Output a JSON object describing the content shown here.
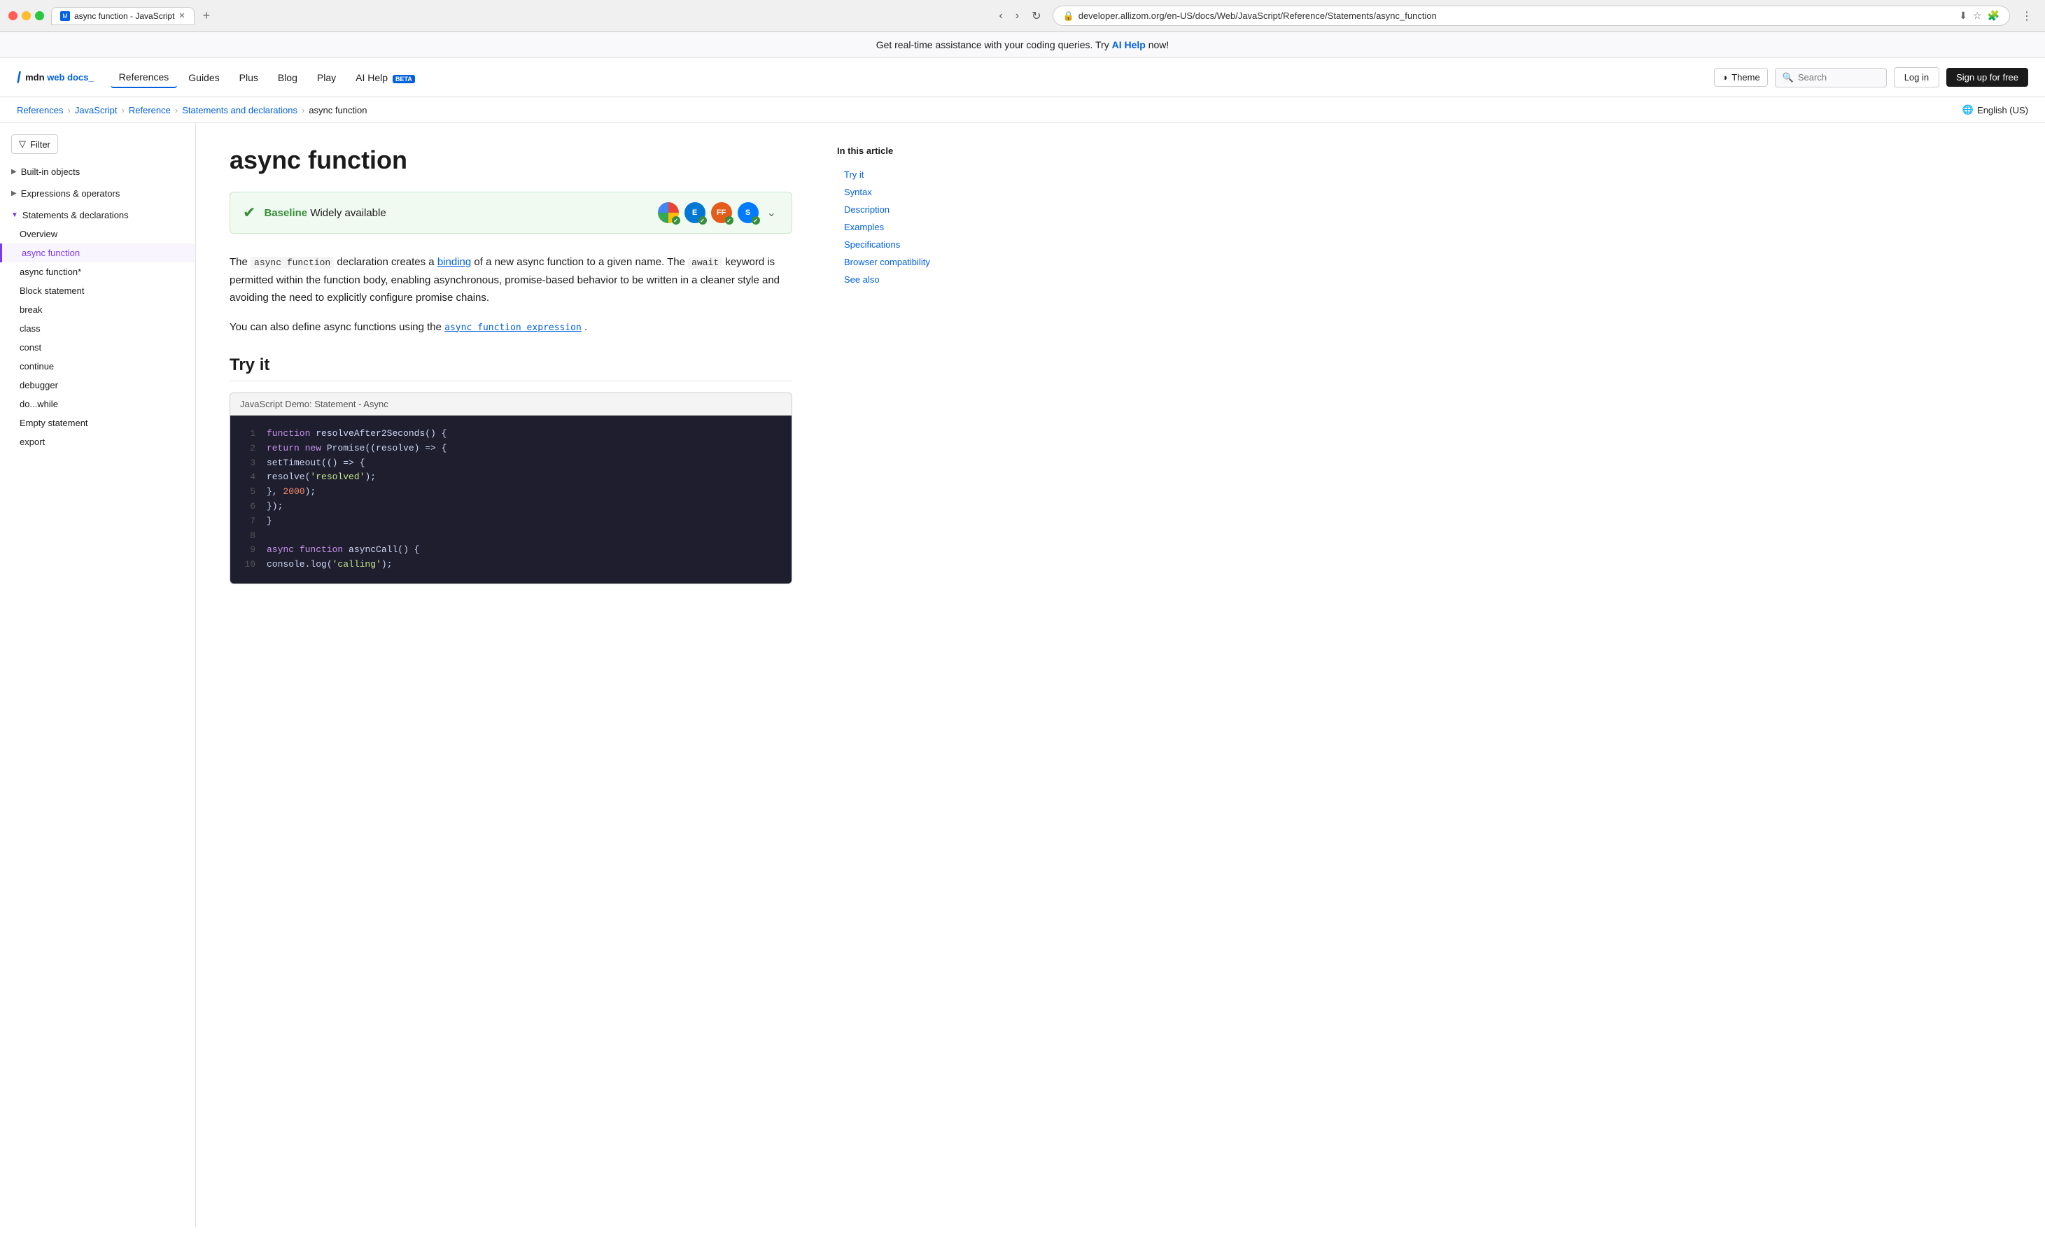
{
  "browser": {
    "tab_title": "async function - JavaScript",
    "url": "developer.allizom.org/en-US/docs/Web/JavaScript/Reference/Statements/async_function",
    "new_tab_label": "+"
  },
  "banner": {
    "text": "Get real-time assistance with your coding queries. Try ",
    "link_text": "AI Help",
    "text_suffix": " now!"
  },
  "header": {
    "logo_text": "mdn web docs",
    "logo_underline": "_",
    "nav": [
      {
        "label": "References",
        "active": true
      },
      {
        "label": "Guides"
      },
      {
        "label": "Plus"
      },
      {
        "label": "Blog"
      },
      {
        "label": "Play"
      },
      {
        "label": "AI Help",
        "badge": "BETA"
      }
    ],
    "theme_label": "Theme",
    "login_label": "Log in",
    "signup_label": "Sign up for free",
    "search_placeholder": "Search"
  },
  "breadcrumb": {
    "items": [
      {
        "label": "References",
        "link": true
      },
      {
        "label": "JavaScript",
        "link": true
      },
      {
        "label": "Reference",
        "link": true
      },
      {
        "label": "Statements and declarations",
        "link": true
      },
      {
        "label": "async function",
        "link": false
      }
    ],
    "lang_label": "English (US)"
  },
  "sidebar": {
    "filter_label": "Filter",
    "groups": [
      {
        "label": "Built-in objects",
        "expanded": false
      },
      {
        "label": "Expressions & operators",
        "expanded": false
      },
      {
        "label": "Statements & declarations",
        "expanded": true
      }
    ],
    "items": [
      {
        "label": "Overview"
      },
      {
        "label": "async function",
        "active": true
      },
      {
        "label": "async function*"
      },
      {
        "label": "Block statement"
      },
      {
        "label": "break"
      },
      {
        "label": "class"
      },
      {
        "label": "const"
      },
      {
        "label": "continue"
      },
      {
        "label": "debugger"
      },
      {
        "label": "do...while"
      },
      {
        "label": "Empty statement"
      },
      {
        "label": "export"
      }
    ]
  },
  "main": {
    "title": "async function",
    "baseline": {
      "label": "Baseline",
      "desc": "Widely available",
      "browsers": [
        "Chrome",
        "Edge",
        "Firefox",
        "Safari"
      ]
    },
    "intro1": "The ",
    "code1": "async function",
    "intro2": " declaration creates a ",
    "link1": "binding",
    "intro3": " of a new async function to a given name. The ",
    "code2": "await",
    "intro4": " keyword is permitted within the function body, enabling asynchronous, promise-based behavior to be written in a cleaner style and avoiding the need to explicitly configure promise chains.",
    "intro5": "You can also define async functions using the ",
    "link2": "async function expression",
    "intro5_suffix": ".",
    "try_it_title": "Try it",
    "demo_label": "JavaScript Demo: Statement - Async",
    "code_lines": [
      {
        "num": 1,
        "tokens": [
          {
            "type": "kw",
            "v": "function"
          },
          {
            "type": "plain",
            "v": " resolveAfter2Seconds() {"
          }
        ]
      },
      {
        "num": 2,
        "tokens": [
          {
            "type": "kw",
            "v": "  return"
          },
          {
            "type": "plain",
            "v": " "
          },
          {
            "type": "kw",
            "v": "new"
          },
          {
            "type": "plain",
            "v": " Promise((resolve) => {"
          }
        ]
      },
      {
        "num": 3,
        "tokens": [
          {
            "type": "plain",
            "v": "    setTimeout(() => {"
          }
        ]
      },
      {
        "num": 4,
        "tokens": [
          {
            "type": "plain",
            "v": "      resolve("
          },
          {
            "type": "str",
            "v": "'resolved'"
          },
          {
            "type": "plain",
            "v": ");"
          }
        ]
      },
      {
        "num": 5,
        "tokens": [
          {
            "type": "plain",
            "v": "    }, "
          },
          {
            "type": "num",
            "v": "2000"
          },
          {
            "type": "plain",
            "v": ");"
          }
        ]
      },
      {
        "num": 6,
        "tokens": [
          {
            "type": "plain",
            "v": "  });"
          }
        ]
      },
      {
        "num": 7,
        "tokens": [
          {
            "type": "plain",
            "v": "}"
          }
        ]
      },
      {
        "num": 8,
        "tokens": [
          {
            "type": "plain",
            "v": ""
          }
        ]
      },
      {
        "num": 9,
        "tokens": [
          {
            "type": "kw",
            "v": "async"
          },
          {
            "type": "plain",
            "v": " "
          },
          {
            "type": "kw",
            "v": "function"
          },
          {
            "type": "plain",
            "v": " asyncCall() {"
          }
        ]
      },
      {
        "num": 10,
        "tokens": [
          {
            "type": "plain",
            "v": "  console.log("
          },
          {
            "type": "str",
            "v": "'calling'"
          },
          {
            "type": "plain",
            "v": ");"
          }
        ]
      }
    ]
  },
  "toc": {
    "title": "In this article",
    "items": [
      {
        "label": "Try it"
      },
      {
        "label": "Syntax"
      },
      {
        "label": "Description"
      },
      {
        "label": "Examples"
      },
      {
        "label": "Specifications"
      },
      {
        "label": "Browser compatibility"
      },
      {
        "label": "See also"
      }
    ]
  }
}
